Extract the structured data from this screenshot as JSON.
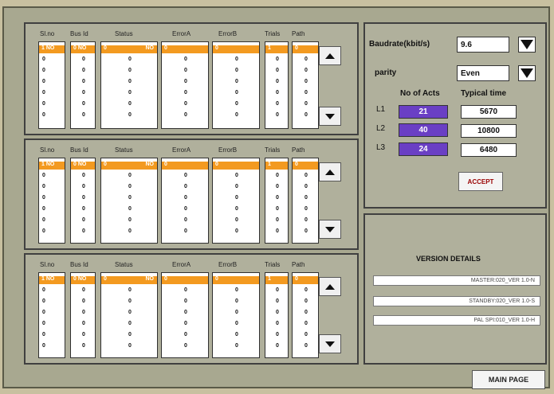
{
  "headers": [
    "Sl.no",
    "Bus Id",
    "Status",
    "ErrorA",
    "ErrorB",
    "Trials",
    "Path"
  ],
  "tables": [
    {
      "selected": [
        "1 NO",
        "0 NO",
        "0",
        "NO",
        "0",
        "0",
        "1",
        "0"
      ],
      "rows_text": [
        "0",
        "0",
        "0",
        "0",
        "0",
        "0"
      ]
    },
    {
      "selected": [
        "1 NO",
        "0 NO",
        "0",
        "NO",
        "0",
        "0",
        "1",
        "0"
      ],
      "rows_text": [
        "0",
        "0",
        "0",
        "0",
        "0",
        "0"
      ]
    },
    {
      "selected": [
        "1 NO",
        "0 NO",
        "0",
        "NO",
        "0",
        "0",
        "1",
        "0"
      ],
      "rows_text": [
        "0",
        "0",
        "0",
        "0",
        "0",
        "0"
      ]
    }
  ],
  "settings": {
    "baudrate_label": "Baudrate(kbit/s)",
    "baudrate_value": "9.6",
    "parity_label": "parity",
    "parity_value": "Even",
    "acts_label": "No of Acts",
    "time_label": "Typical time",
    "lines": [
      {
        "name": "L1",
        "acts": "21",
        "time": "5670"
      },
      {
        "name": "L2",
        "acts": "40",
        "time": "10800"
      },
      {
        "name": "L3",
        "acts": "24",
        "time": "6480"
      }
    ],
    "accept_label": "ACCEPT"
  },
  "version": {
    "title": "VERSION DETAILS",
    "lines": [
      "MASTER:020_VER 1.0-N",
      "STANDBY:020_VER 1.0-S",
      "PAL SPI:010_VER 1.0-H"
    ]
  },
  "main_page_label": "MAIN PAGE",
  "colors": {
    "selected_row": "#f39a20",
    "acts_box": "#6a3fc4",
    "panel": "#b0b09c"
  }
}
